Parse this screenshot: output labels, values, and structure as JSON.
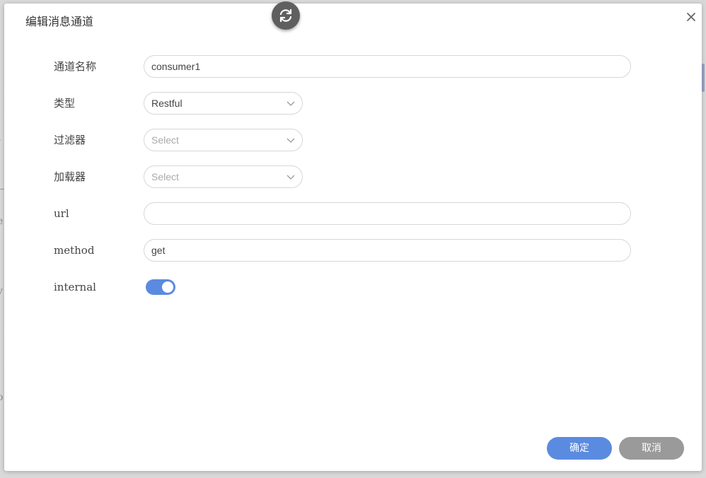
{
  "dialog": {
    "title": "编辑消息通道",
    "fields": {
      "name": {
        "label": "通道名称",
        "value": "consumer1"
      },
      "type": {
        "label": "类型",
        "value": "Restful"
      },
      "filter": {
        "label": "过滤器",
        "placeholder": "Select"
      },
      "loader": {
        "label": "加载器",
        "placeholder": "Select"
      },
      "url": {
        "label": "url",
        "value": ""
      },
      "method": {
        "label": "method",
        "value": "get"
      },
      "internal": {
        "label": "internal",
        "enabled": true
      }
    },
    "buttons": {
      "confirm": "确定",
      "cancel": "取消"
    }
  },
  "colors": {
    "primary": "#5b8be0",
    "secondary": "#9a9a9a",
    "floating_button": "#5f5f5f"
  },
  "icons": {
    "close": "close-icon",
    "sync": "sync-icon",
    "chevron": "chevron-down-icon"
  }
}
